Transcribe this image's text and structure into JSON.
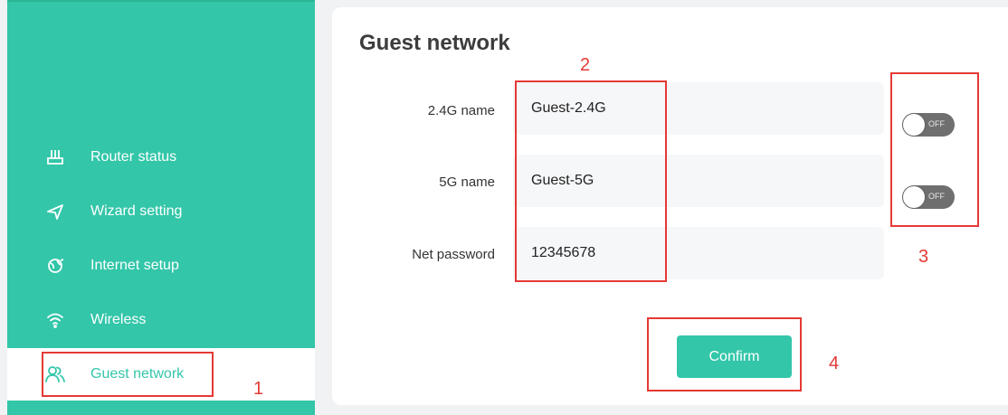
{
  "sidebar": {
    "items": [
      {
        "label": "Router status",
        "icon": "router-icon"
      },
      {
        "label": "Wizard setting",
        "icon": "navigation-arrow-icon"
      },
      {
        "label": "Internet setup",
        "icon": "globe-icon"
      },
      {
        "label": "Wireless",
        "icon": "wifi-icon"
      },
      {
        "label": "Guest network",
        "icon": "guests-icon",
        "active": true
      }
    ]
  },
  "main": {
    "title": "Guest network",
    "fields": [
      {
        "label": "2.4G name",
        "value": "Guest-2.4G",
        "toggle": "OFF"
      },
      {
        "label": "5G name",
        "value": "Guest-5G",
        "toggle": "OFF"
      },
      {
        "label": "Net password",
        "value": "12345678"
      }
    ],
    "confirm_label": "Confirm"
  },
  "annotations": {
    "a1": "1",
    "a2": "2",
    "a3": "3",
    "a4": "4"
  },
  "colors": {
    "accent": "#33c6a9",
    "highlight": "#e53935",
    "toggle_off": "#6f6f6f"
  }
}
